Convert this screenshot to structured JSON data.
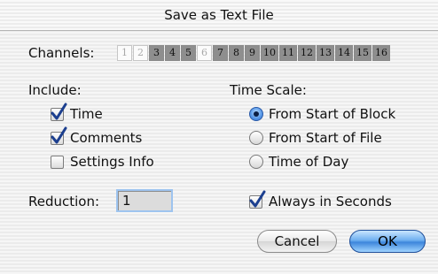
{
  "window": {
    "title": "Save as Text File"
  },
  "channels": {
    "label": "Channels:",
    "items": [
      {
        "label": "1",
        "selected": false
      },
      {
        "label": "2",
        "selected": false
      },
      {
        "label": "3",
        "selected": true
      },
      {
        "label": "4",
        "selected": true
      },
      {
        "label": "5",
        "selected": true
      },
      {
        "label": "6",
        "selected": false
      },
      {
        "label": "7",
        "selected": true
      },
      {
        "label": "8",
        "selected": true
      },
      {
        "label": "9",
        "selected": true
      },
      {
        "label": "10",
        "selected": true
      },
      {
        "label": "11",
        "selected": true
      },
      {
        "label": "12",
        "selected": true
      },
      {
        "label": "13",
        "selected": true
      },
      {
        "label": "14",
        "selected": true
      },
      {
        "label": "15",
        "selected": true
      },
      {
        "label": "16",
        "selected": true
      }
    ]
  },
  "include": {
    "label": "Include:",
    "time": {
      "label": "Time",
      "checked": true
    },
    "comments": {
      "label": "Comments",
      "checked": true
    },
    "settings_info": {
      "label": "Settings Info",
      "checked": false
    }
  },
  "time_scale": {
    "label": "Time Scale:",
    "from_start_of_block": {
      "label": "From Start of Block",
      "selected": true
    },
    "from_start_of_file": {
      "label": "From Start of File",
      "selected": false
    },
    "time_of_day": {
      "label": "Time of Day",
      "selected": false
    }
  },
  "reduction": {
    "label": "Reduction:",
    "value": "1"
  },
  "always_in_seconds": {
    "label": "Always in Seconds",
    "checked": true
  },
  "buttons": {
    "cancel": "Cancel",
    "ok": "OK"
  },
  "colors": {
    "accent": "#3d86dc",
    "channel_on": "#8e8e8e",
    "channel_off": "#fbfbfb"
  }
}
